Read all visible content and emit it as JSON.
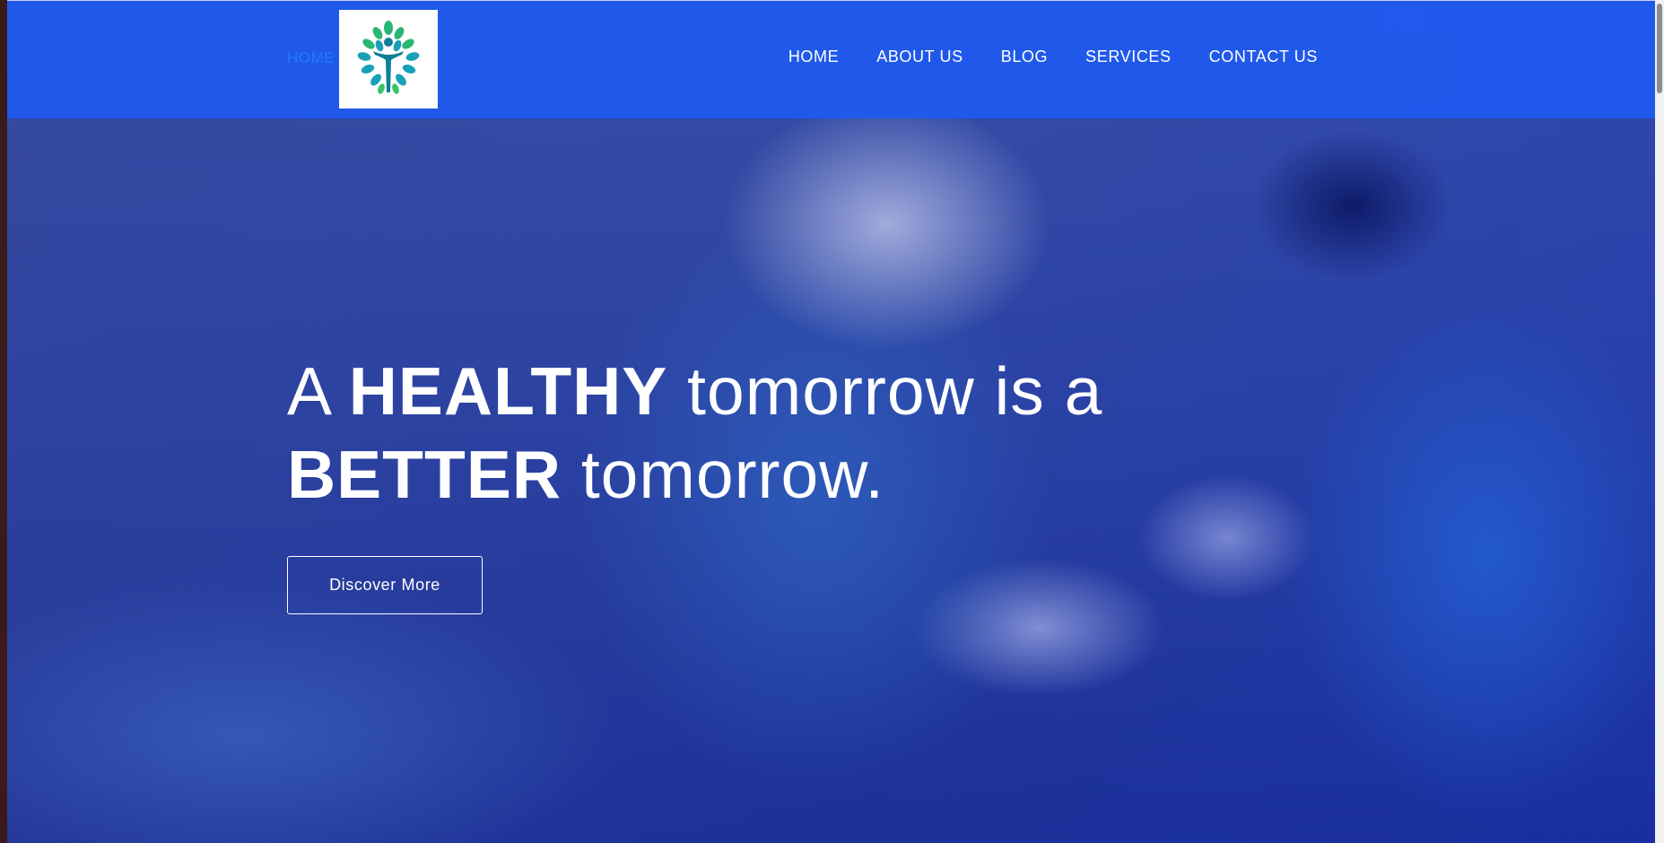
{
  "header": {
    "home_link": "HOME",
    "logo_icon": "tree-person-logo-icon",
    "nav": [
      {
        "label": "HOME"
      },
      {
        "label": "ABOUT US"
      },
      {
        "label": "BLOG"
      },
      {
        "label": "SERVICES"
      },
      {
        "label": "CONTACT US"
      }
    ]
  },
  "hero": {
    "title_part1": "A ",
    "title_bold1": "HEALTHY",
    "title_part2": " tomorrow is a",
    "title_bold2": "BETTER",
    "title_part3": " tomorrow.",
    "button_label": "Discover More"
  },
  "colors": {
    "header_bg": "#1e5af0",
    "home_link": "#1f7bff",
    "text": "#ffffff"
  }
}
